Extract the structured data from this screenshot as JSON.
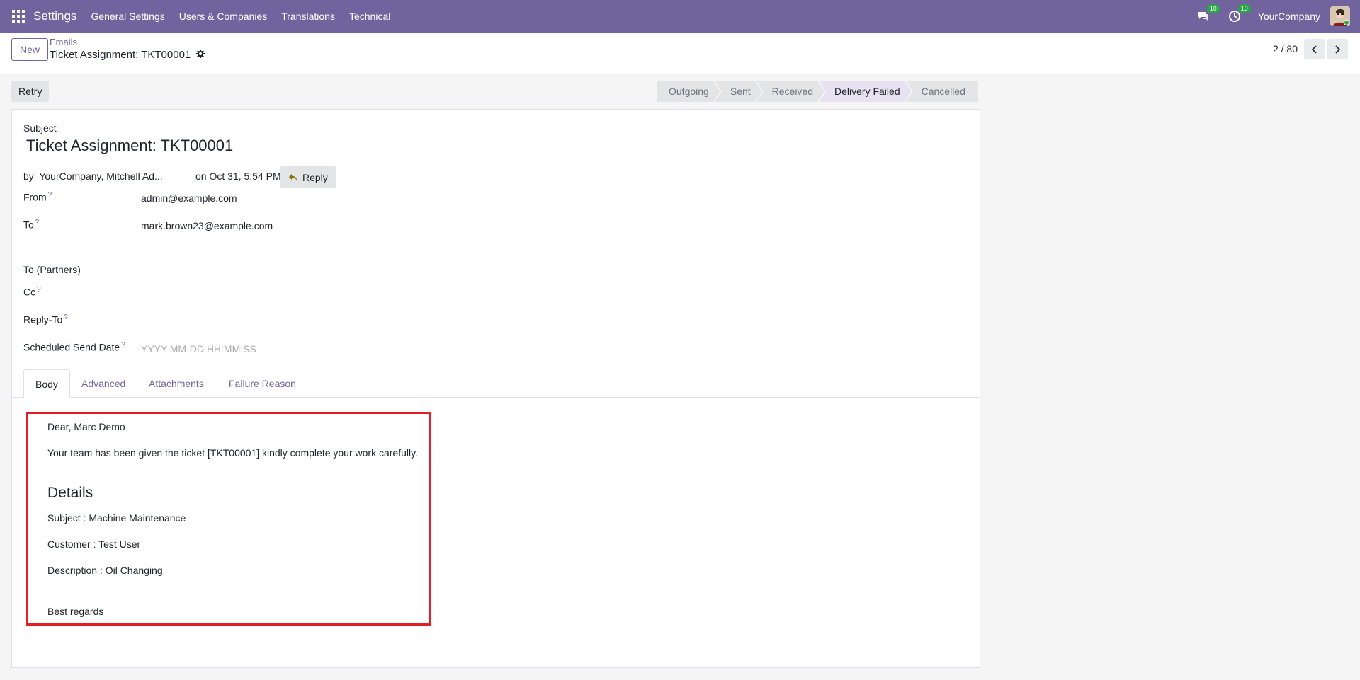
{
  "navbar": {
    "brand": "Settings",
    "menu": [
      "General Settings",
      "Users & Companies",
      "Translations",
      "Technical"
    ],
    "messages_count": "10",
    "activities_count": "10",
    "company": "YourCompany"
  },
  "control": {
    "new_label": "New",
    "breadcrumb_parent": "Emails",
    "breadcrumb_current": "Ticket Assignment: TKT00001",
    "pager": "2 / 80"
  },
  "actions": {
    "retry_label": "Retry"
  },
  "statusbar": {
    "stages": [
      "Outgoing",
      "Sent",
      "Received",
      "Delivery Failed",
      "Cancelled"
    ],
    "active": "Delivery Failed"
  },
  "form": {
    "subject_label": "Subject",
    "subject": "Ticket Assignment: TKT00001",
    "by_label": "by",
    "author": "YourCompany, Mitchell Ad...",
    "date": "on Oct 31, 5:54 PM",
    "reply_label": "Reply",
    "from_label": "From",
    "from_value": "admin@example.com",
    "to_label": "To",
    "to_value": "mark.brown23@example.com",
    "to_partners_label": "To (Partners)",
    "cc_label": "Cc",
    "reply_to_label": "Reply-To",
    "scheduled_label": "Scheduled Send Date",
    "scheduled_placeholder": "YYYY-MM-DD HH:MM:SS",
    "help_mark": "?"
  },
  "tabs": [
    "Body",
    "Advanced",
    "Attachments",
    "Failure Reason"
  ],
  "body": {
    "greeting": "Dear, Marc Demo",
    "line1": "Your team has been given the ticket [TKT00001] kindly complete your work carefully.",
    "details_heading": "Details",
    "subject_line": "Subject : Machine Maintenance",
    "customer_line": "Customer : Test User",
    "description_line": "Description : Oil Changing",
    "closing": "Best regards"
  },
  "colors": {
    "brand": "#71639e",
    "highlight": "#e31e24"
  }
}
